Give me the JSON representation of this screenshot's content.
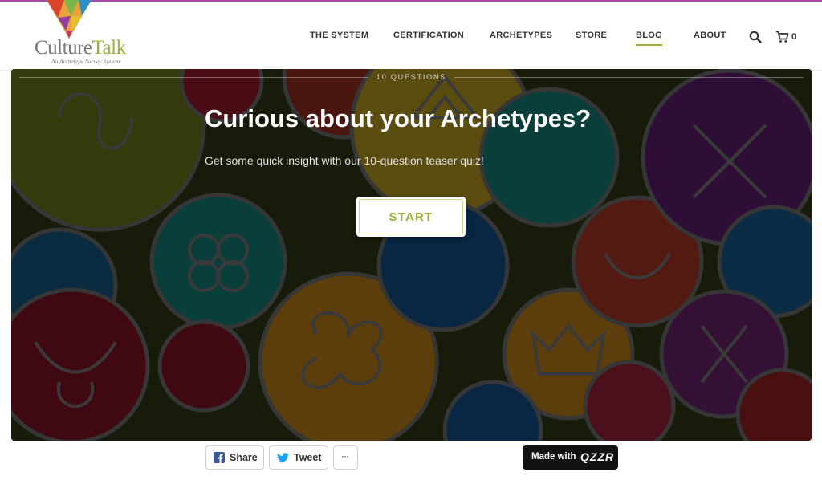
{
  "header": {
    "logo": {
      "name_part1": "Culture",
      "name_part2": "Talk",
      "tagline": "An Archetype Survey System"
    },
    "nav": [
      {
        "label": "THE SYSTEM",
        "active": false
      },
      {
        "label": "CERTIFICATION",
        "active": false
      },
      {
        "label": "ARCHETYPES",
        "active": false
      },
      {
        "label": "STORE",
        "active": false
      },
      {
        "label": "BLOG",
        "active": true
      },
      {
        "label": "ABOUT",
        "active": false
      }
    ],
    "search_icon": "search-icon",
    "cart_icon": "cart-icon",
    "cart_count": "0"
  },
  "quiz": {
    "question_count": "10 QUESTIONS",
    "title": "Curious about your Archetypes?",
    "subtitle": "Get some quick insight with our 10-question teaser quiz!",
    "start_label": "START"
  },
  "share": {
    "facebook_label": "Share",
    "twitter_label": "Tweet",
    "more_label": "···",
    "made_with_label": "Made with",
    "made_with_brand": "QZZR"
  },
  "colors": {
    "accent_green": "#9bb13b",
    "top_border": "#a64aa8",
    "facebook": "#3b5998",
    "twitter": "#1da1f2"
  }
}
